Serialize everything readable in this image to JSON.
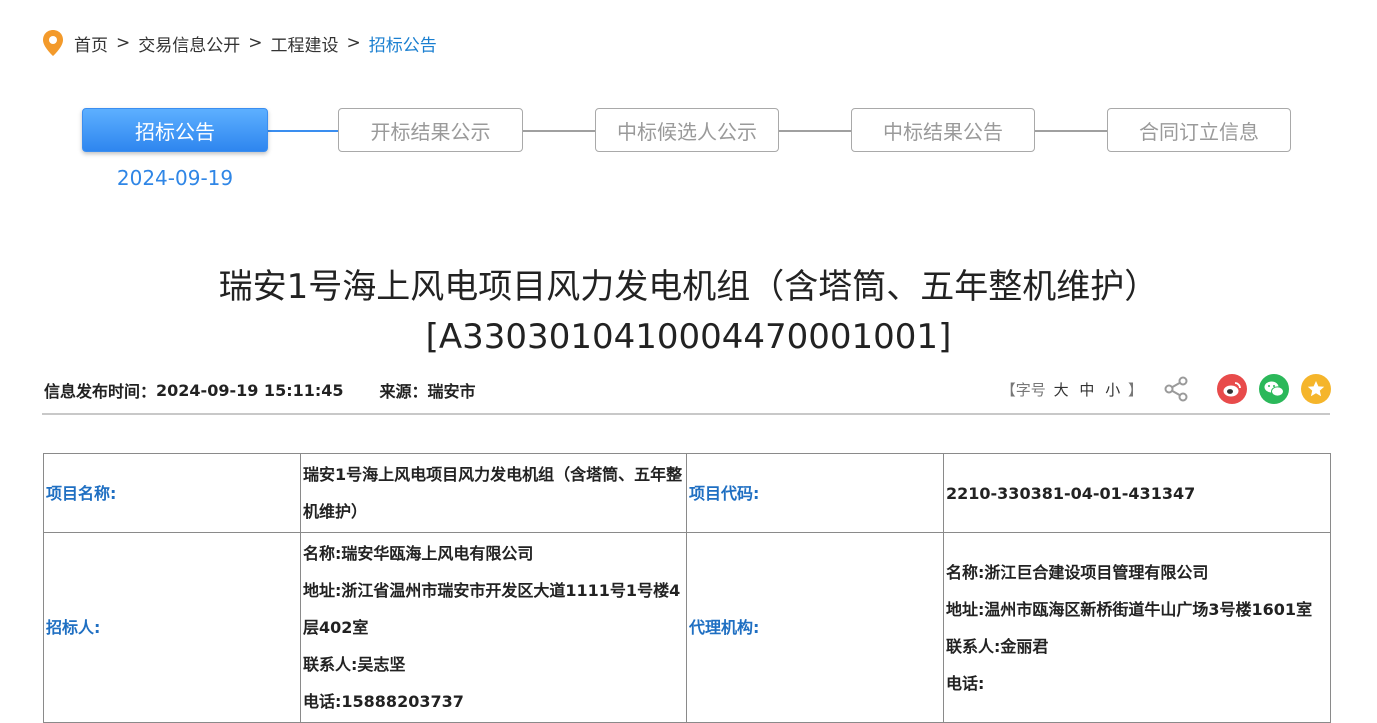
{
  "breadcrumb": {
    "items": [
      "首页",
      "交易信息公开",
      "工程建设"
    ],
    "current": "招标公告",
    "separator": ">"
  },
  "steps": [
    {
      "label": "招标公告",
      "active": true,
      "date": "2024-09-19"
    },
    {
      "label": "开标结果公示",
      "active": false
    },
    {
      "label": "中标候选人公示",
      "active": false
    },
    {
      "label": "中标结果公告",
      "active": false
    },
    {
      "label": "合同订立信息",
      "active": false
    }
  ],
  "title": {
    "line1": "瑞安1号海上风电项目风力发电机组（含塔筒、五年整机维护）",
    "line2": "[A3303010410004470001001]"
  },
  "meta": {
    "publish_label": "信息发布时间：",
    "publish_time": "2024-09-19 15:11:45",
    "source_label": "来源：",
    "source": "瑞安市"
  },
  "tools": {
    "fontsize_open": "【字号",
    "large": "大",
    "medium": "中",
    "small": "小",
    "fontsize_close": "】"
  },
  "icons": [
    "location-pin-icon",
    "share-icon",
    "weibo-icon",
    "wechat-icon",
    "favorite-star-icon"
  ],
  "colors": {
    "accent": "#2f86e6",
    "label_blue": "#1f6fc2",
    "weibo": "#e84b4b",
    "wechat": "#2bb85a",
    "favorite": "#f5b52b"
  },
  "table": {
    "project_name_label": "项目名称:",
    "project_name": "瑞安1号海上风电项目风力发电机组（含塔筒、五年整机维护）",
    "project_code_label": "项目代码:",
    "project_code": "2210-330381-04-01-431347",
    "tenderer_label": "招标人:",
    "tenderer": {
      "name": "名称:瑞安华瓯海上风电有限公司",
      "address": "地址:浙江省温州市瑞安市开发区大道1111号1号楼4层402室",
      "contact": "联系人:吴志坚",
      "phone": "电话:15888203737"
    },
    "agency_label": "代理机构:",
    "agency": {
      "name": "名称:浙江巨合建设项目管理有限公司",
      "address": "地址:温州市瓯海区新桥街道牛山广场3号楼1601室",
      "contact": "联系人:金丽君",
      "phone": "电话:"
    }
  }
}
